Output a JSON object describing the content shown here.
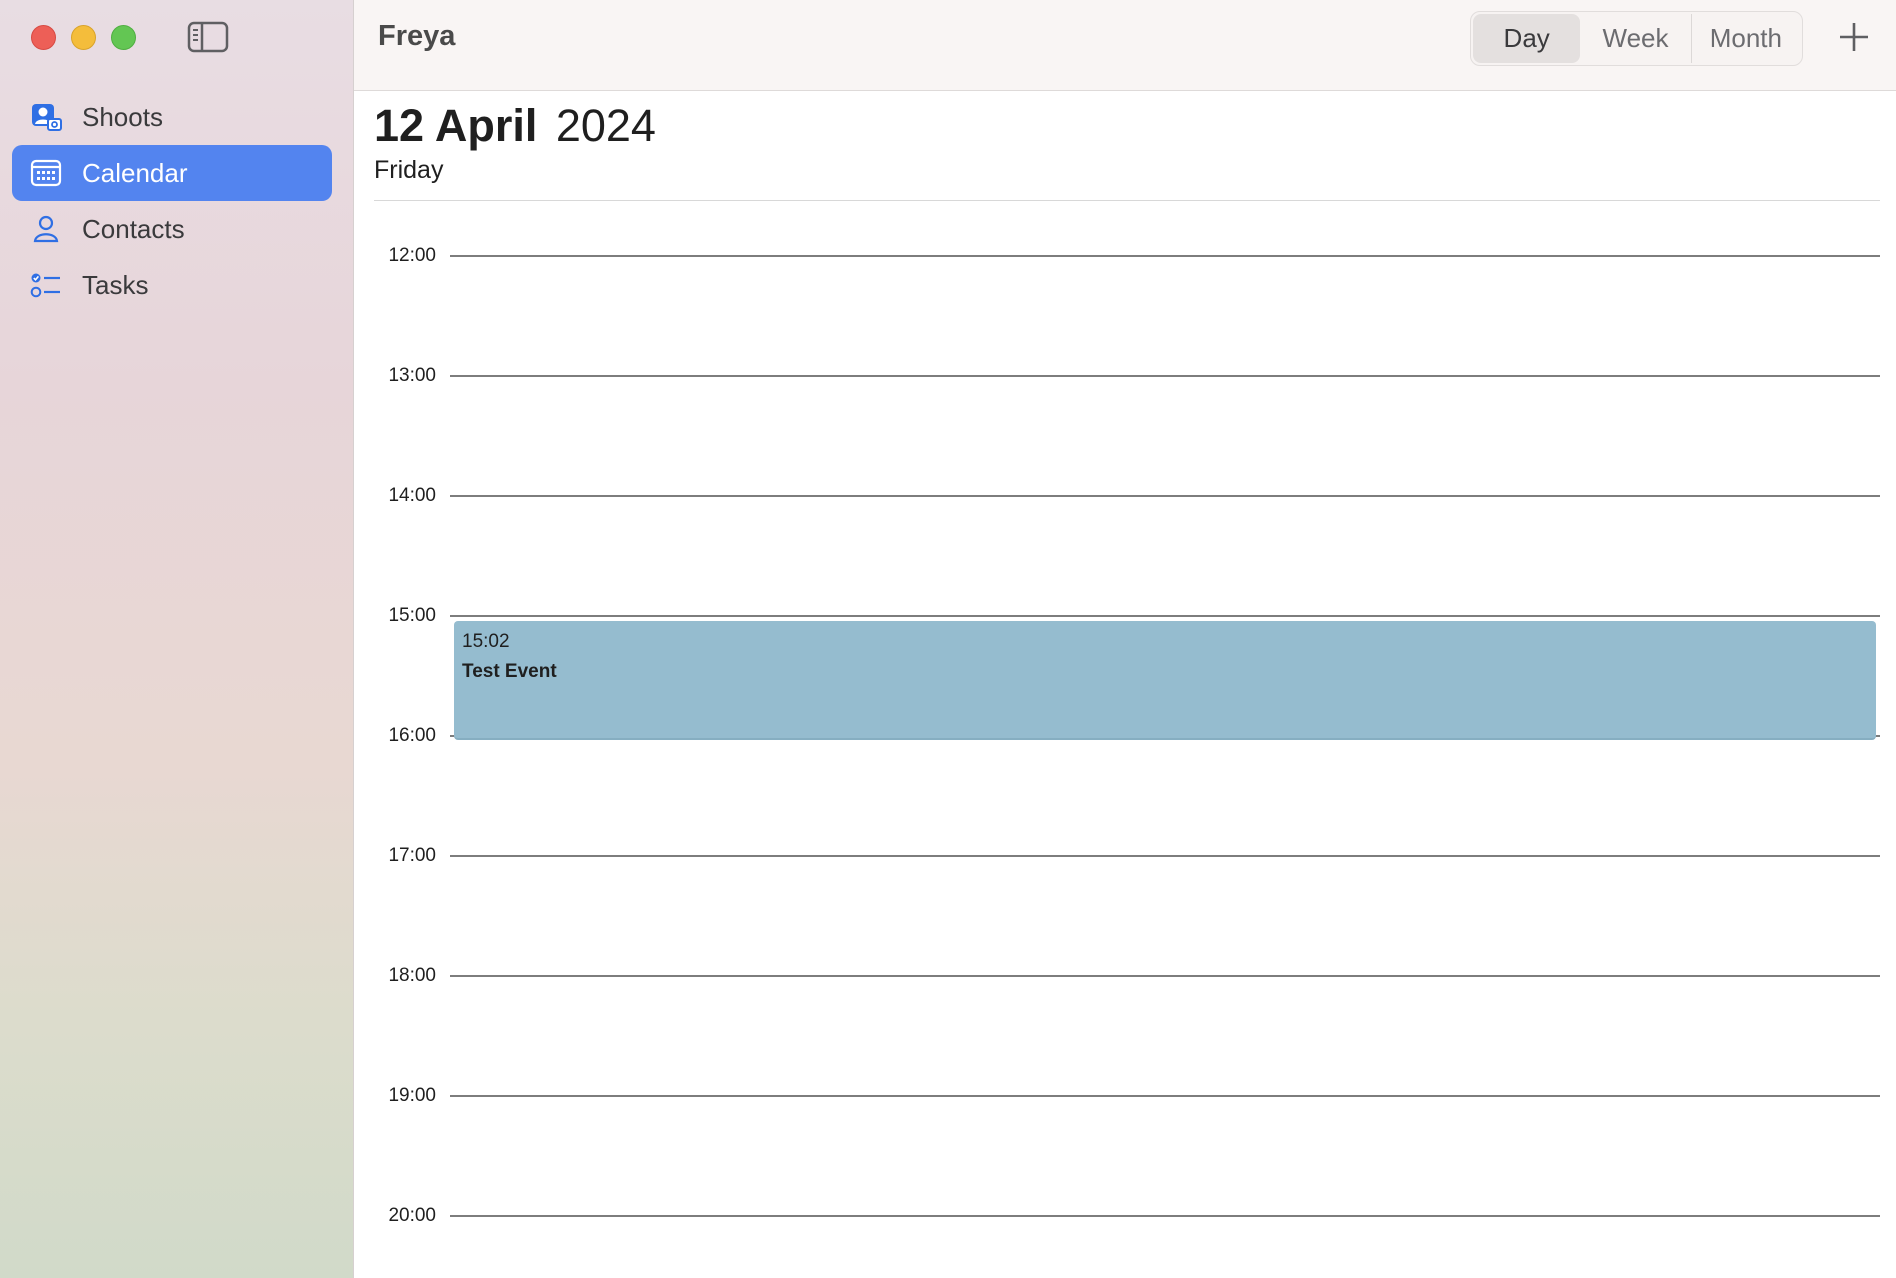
{
  "window": {
    "controls": [
      "close",
      "minimize",
      "zoom"
    ]
  },
  "sidebar": {
    "items": [
      {
        "label": "Shoots",
        "icon": "person-camera-icon",
        "active": false
      },
      {
        "label": "Calendar",
        "icon": "calendar-icon",
        "active": true
      },
      {
        "label": "Contacts",
        "icon": "person-icon",
        "active": false
      },
      {
        "label": "Tasks",
        "icon": "checklist-icon",
        "active": false
      }
    ]
  },
  "toolbar": {
    "title": "Freya",
    "views": [
      "Day",
      "Week",
      "Month"
    ],
    "selected_view": "Day",
    "add_icon": "plus-icon"
  },
  "date": {
    "day_month": "12 April",
    "year": "2024",
    "weekday": "Friday"
  },
  "hours": [
    "12:00",
    "13:00",
    "14:00",
    "15:00",
    "16:00",
    "17:00",
    "18:00",
    "19:00",
    "20:00"
  ],
  "events": [
    {
      "time": "15:02",
      "title": "Test Event"
    }
  ],
  "colors": {
    "accent": "#5384ef",
    "event_bg": "#95bccf",
    "icon_blue": "#2f6fe4"
  }
}
